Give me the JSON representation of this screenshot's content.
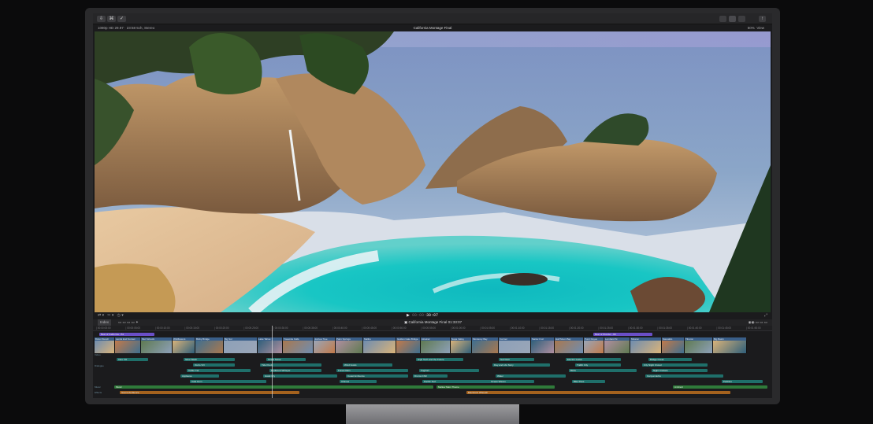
{
  "app": {
    "project_title": "California Montage Final",
    "format_info": "1080p HD 29.97 · 23:58 5ch, Stereo",
    "zoom": "50%",
    "view_menu": "View"
  },
  "transport": {
    "timecode_dim": "00:00:",
    "timecode": "30:07",
    "index_button": "Index",
    "timeline_title": "California Montage Final",
    "timeline_duration": "01:33:07"
  },
  "ruler": [
    "00:00:00:00",
    "00:00:05:00",
    "00:00:10:00",
    "00:00:15:00",
    "00:00:20:00",
    "00:00:25:00",
    "00:00:30:00",
    "00:00:35:00",
    "00:00:40:00",
    "00:00:45:00",
    "00:00:50:00",
    "00:00:55:00",
    "00:01:00:00",
    "00:01:05:00",
    "00:01:10:00",
    "00:01:15:00",
    "00:01:20:00",
    "00:01:25:00",
    "00:01:30:00",
    "00:01:35:00",
    "00:01:40:00",
    "00:01:45:00",
    "00:01:50:00"
  ],
  "track_labels": [
    "Title Overlay",
    "Video",
    "Dialogue",
    "Music",
    "Effects"
  ],
  "titles": [
    "Best of California - B1",
    "Best of Wonder - B2"
  ],
  "video_clips": [
    "Baker Beach",
    "Lands End Sunset",
    "Muir Woods",
    "Wildflowers",
    "Bixby Bridge",
    "Big Sur",
    "Lake Tahoe",
    "Yosemite Falls",
    "Joshua Tree",
    "Palm Springs",
    "Malibu",
    "Golden Gate Bridge",
    "Alcatraz",
    "Napa Valley",
    "Monterey Bay",
    "Carmel",
    "Santa Cruz",
    "Half Moon Bay",
    "Point Reyes",
    "Lombard St",
    "Mission",
    "Sausalito",
    "Tiburon",
    "Big Basin",
    "Pismo"
  ],
  "audio_clips": [
    "Intro VO",
    "Outro VO",
    "Redwood Whisper",
    "Coast Ambience",
    "Pacific Surf",
    "Surf Roll",
    "Traffic City",
    "Night Crickets",
    "Seagulls",
    "Cafe Hum",
    "Street Noise",
    "Wind Gusts",
    "Foghorn",
    "Water",
    "Bike Pass",
    "Bridge Creak",
    "City Tour Market Street",
    "Cable Car",
    "Hawk Cry",
    "Chimes",
    "High Tech and the Future",
    "Day and Life Story",
    "Birds",
    "Canyon Echo",
    "Pebbles",
    "Slow Wash",
    "Tide Pools",
    "Forest Rain",
    "Drums Chill",
    "Ocean Waves",
    "Electric Guitar",
    "City Night Crowd",
    "Underwater",
    "Applause"
  ],
  "music": [
    "Music",
    "Mellow Main Theme",
    "Ambient"
  ],
  "effects": [
    "Sound Ambience",
    "Electronic Whoosh",
    "Transitions"
  ]
}
